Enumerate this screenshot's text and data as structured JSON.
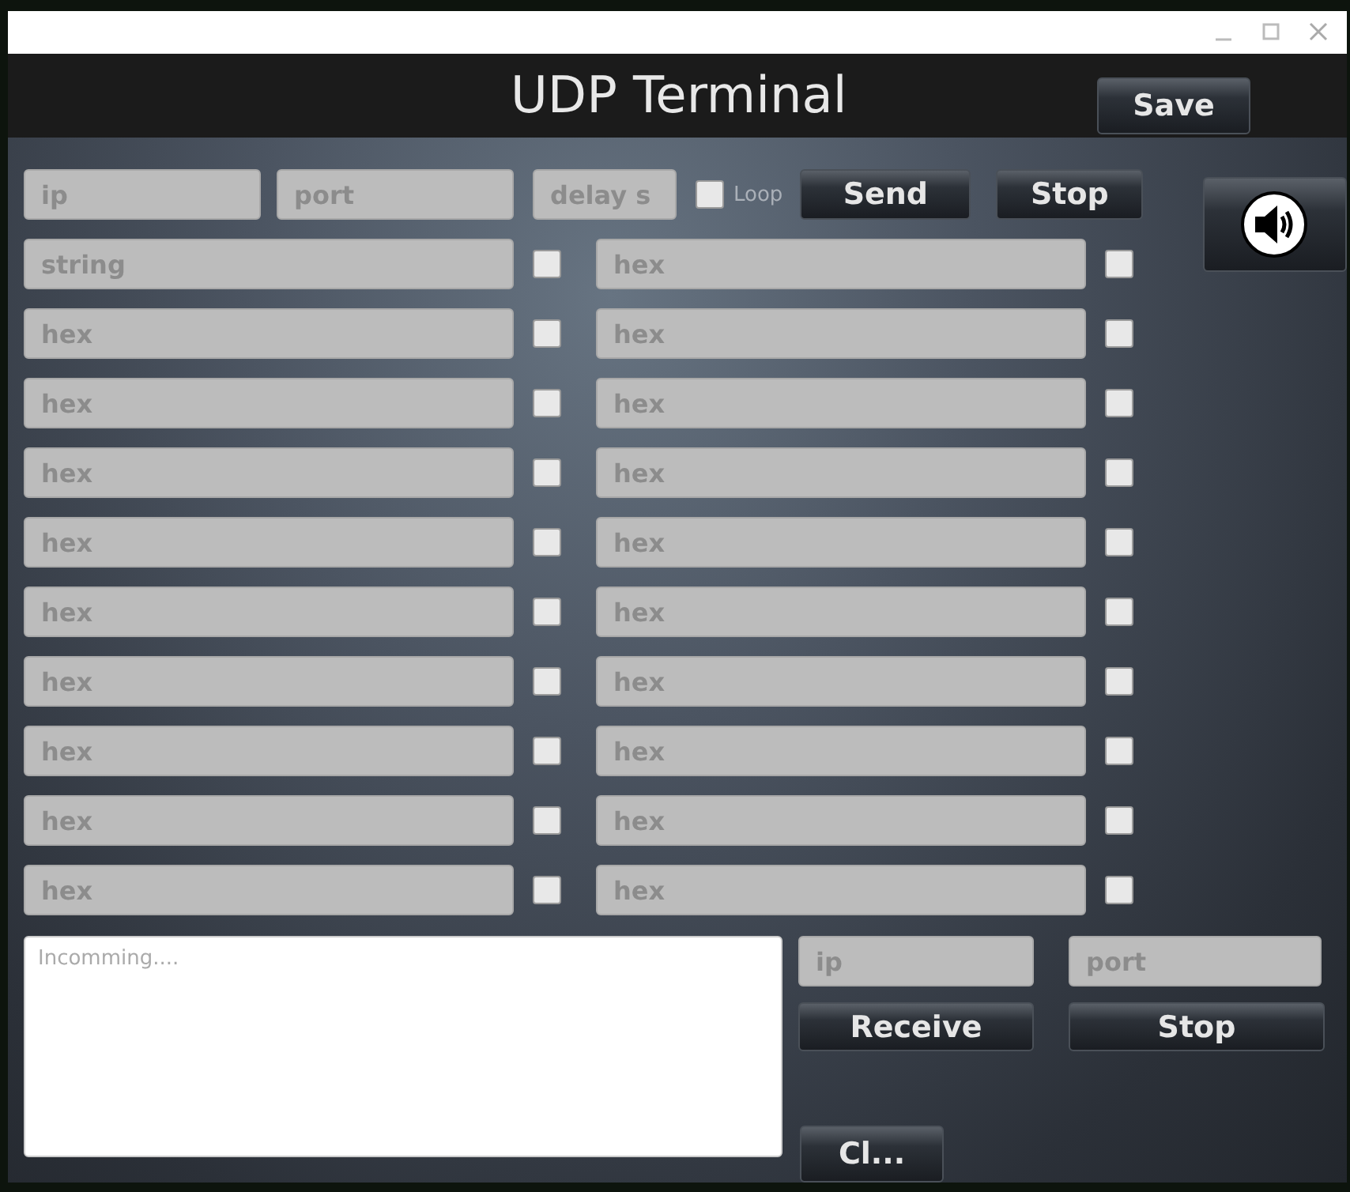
{
  "window": {
    "title": "UDP Terminal"
  },
  "header": {
    "save_button": "Save"
  },
  "send": {
    "ip": {
      "placeholder": "ip"
    },
    "port": {
      "placeholder": "port"
    },
    "delay": {
      "placeholder": "delay s"
    },
    "loop": {
      "label": "Loop",
      "checked": false
    },
    "buttons": [
      "Send",
      "Stop"
    ]
  },
  "rows": [
    {
      "left": {
        "placeholder": "string",
        "checked": false
      },
      "right": {
        "placeholder": "hex",
        "checked": false
      }
    },
    {
      "left": {
        "placeholder": "hex",
        "checked": false
      },
      "right": {
        "placeholder": "hex",
        "checked": false
      }
    },
    {
      "left": {
        "placeholder": "hex",
        "checked": false
      },
      "right": {
        "placeholder": "hex",
        "checked": false
      }
    },
    {
      "left": {
        "placeholder": "hex",
        "checked": false
      },
      "right": {
        "placeholder": "hex",
        "checked": false
      }
    },
    {
      "left": {
        "placeholder": "hex",
        "checked": false
      },
      "right": {
        "placeholder": "hex",
        "checked": false
      }
    },
    {
      "left": {
        "placeholder": "hex",
        "checked": false
      },
      "right": {
        "placeholder": "hex",
        "checked": false
      }
    },
    {
      "left": {
        "placeholder": "hex",
        "checked": false
      },
      "right": {
        "placeholder": "hex",
        "checked": false
      }
    },
    {
      "left": {
        "placeholder": "hex",
        "checked": false
      },
      "right": {
        "placeholder": "hex",
        "checked": false
      }
    },
    {
      "left": {
        "placeholder": "hex",
        "checked": false
      },
      "right": {
        "placeholder": "hex",
        "checked": false
      }
    },
    {
      "left": {
        "placeholder": "hex",
        "checked": false
      },
      "right": {
        "placeholder": "hex",
        "checked": false
      }
    }
  ],
  "receive": {
    "log": {
      "placeholder": "Incomming...."
    },
    "ip": {
      "placeholder": "ip"
    },
    "port": {
      "placeholder": "port"
    },
    "buttons": [
      "Receive",
      "Stop"
    ],
    "clear_button": "Cl..."
  }
}
